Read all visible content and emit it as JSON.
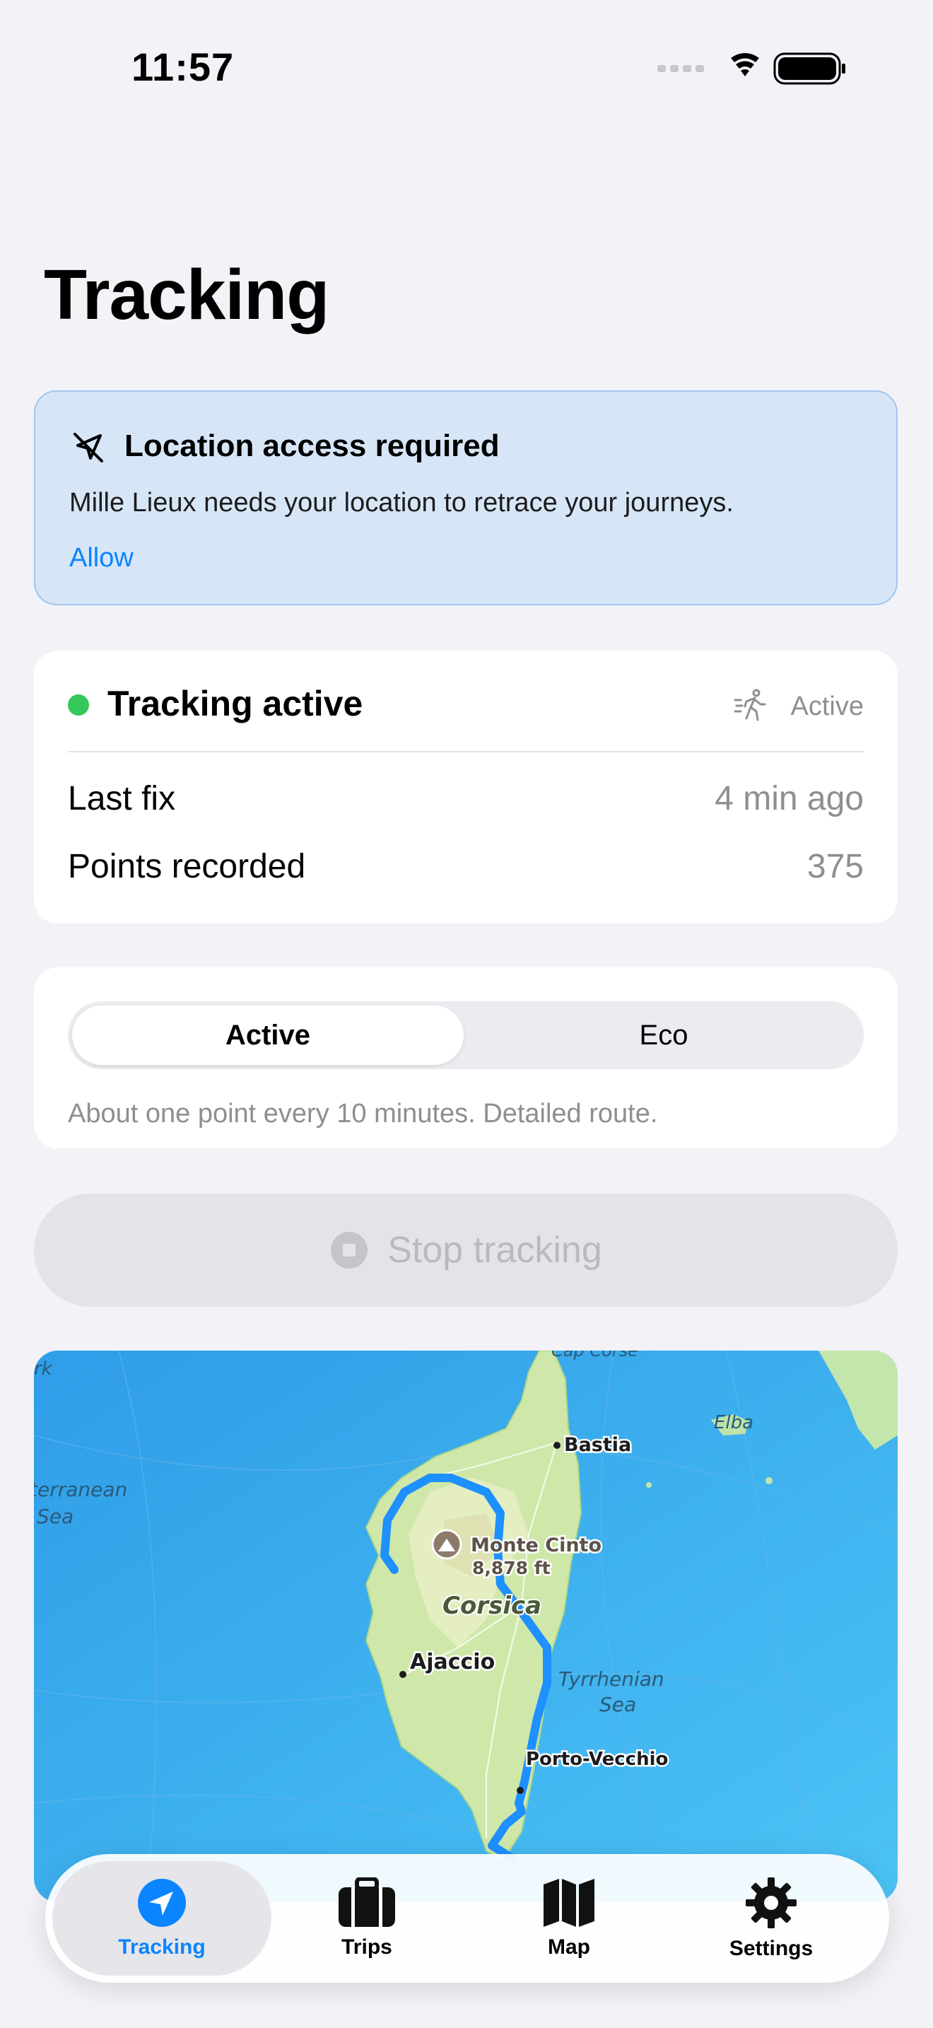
{
  "status_bar": {
    "time": "11:57"
  },
  "page": {
    "title": "Tracking"
  },
  "location_banner": {
    "title": "Location access required",
    "message": "Mille Lieux needs your location to retrace your journeys.",
    "action_label": "Allow",
    "icon": "location-slash-icon"
  },
  "tracking_status": {
    "title": "Tracking active",
    "badge_label": "Active",
    "badge_icon": "walking-figure-icon",
    "rows": [
      {
        "label": "Last fix",
        "value": "4 min ago"
      },
      {
        "label": "Points recorded",
        "value": "375"
      }
    ]
  },
  "mode": {
    "options": [
      "Active",
      "Eco"
    ],
    "selected": "Active",
    "description": "About one point every 10 minutes. Detailed route."
  },
  "stop_button": {
    "label": "Stop tracking",
    "enabled": false
  },
  "map": {
    "labels": {
      "cap_corse": "Cap Corse",
      "bastia": "Bastia",
      "elba": "Elba",
      "monte_cinto": "Monte Cinto",
      "elevation": "8,878 ft",
      "corsica": "Corsica",
      "ajaccio": "Ajaccio",
      "tyrrhenian_1": "Tyrrhenian",
      "tyrrhenian_2": "Sea",
      "mediterranean_1": "terranean",
      "mediterranean_2": "Sea",
      "porto_vecchio": "Porto-Vecchio",
      "edge_park": "rk"
    },
    "route_color": "#1e90ff"
  },
  "tab_bar": {
    "tabs": [
      {
        "label": "Tracking",
        "icon": "location-arrow-icon",
        "selected": true
      },
      {
        "label": "Trips",
        "icon": "suitcase-icon",
        "selected": false
      },
      {
        "label": "Map",
        "icon": "map-icon",
        "selected": false
      },
      {
        "label": "Settings",
        "icon": "gear-icon",
        "selected": false
      }
    ]
  },
  "colors": {
    "accent": "#0a84ff",
    "active_dot": "#34c759",
    "banner_bg": "#d7e6f7"
  }
}
